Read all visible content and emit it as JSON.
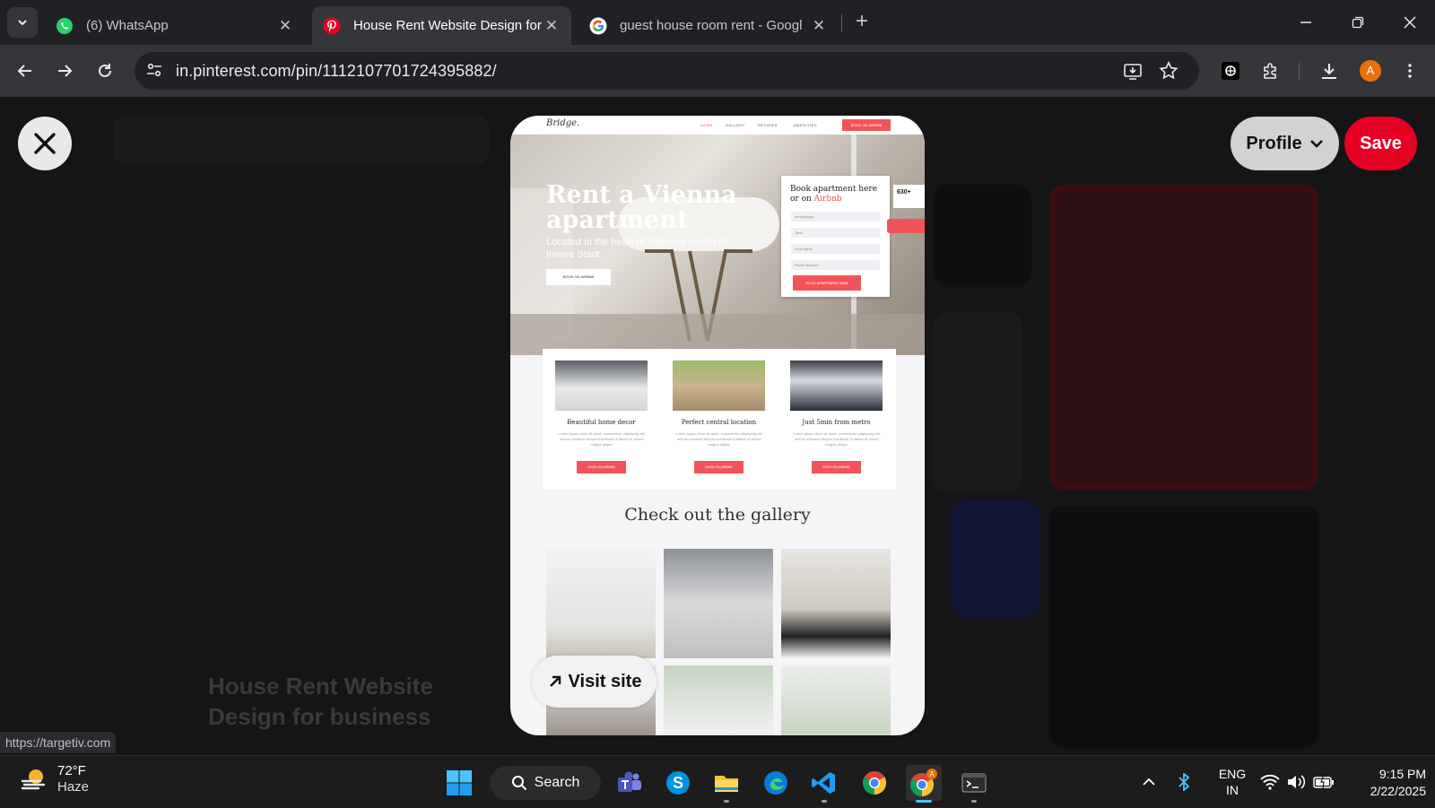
{
  "browser": {
    "tabs": [
      {
        "title": "(6) WhatsApp",
        "favicon": "whatsapp-icon",
        "active": false
      },
      {
        "title": "House Rent Website Design for",
        "favicon": "pinterest-icon",
        "active": true
      },
      {
        "title": "guest house room rent - Googl",
        "favicon": "google-icon",
        "active": false
      }
    ],
    "new_tab": "+",
    "url": "in.pinterest.com/pin/1112107701724395882/",
    "profile_initial": "A",
    "status_url": "https://targetiv.com"
  },
  "pin_page": {
    "profile_label": "Profile",
    "save_label": "Save",
    "visit_label": "Visit site",
    "background_title": "House Rent Website Design for business"
  },
  "mockup": {
    "logo": "Bridge.",
    "nav": [
      "HOME",
      "GALLERY",
      "REVIEWS",
      "AMENITIES"
    ],
    "nav_cta": "BOOK ON AIRBNB",
    "hero_title": "Rent a Vienna apartment",
    "hero_sub": "Located in the heart of historical center of Innere Stadt",
    "hero_button": "BOOK ON AIRBNB",
    "form_title_1": "Book apartment here",
    "form_title_2": "or on ",
    "form_airbnb": "Airbnb",
    "form_fields": [
      "mm/dd/yyyy",
      "Time",
      "Your Name",
      "Phone Number"
    ],
    "form_button": "BOOK APARTMENT NOW",
    "reviews_count": "630+",
    "features": [
      {
        "title": "Beautiful home decor",
        "text": "Lorem ipsum dolor sit amet, consectetur adipiscing elit, sed do eiusmod tempor incididunt ut labore et dolore magna aliqua.",
        "button": "BOOK ON AIRBNB"
      },
      {
        "title": "Perfect central location",
        "text": "Lorem ipsum dolor sit amet, consectetur adipiscing elit, sed do eiusmod tempor incididunt ut labore et dolore magna aliqua.",
        "button": "BOOK ON AIRBNB"
      },
      {
        "title": "Just 5min from metro",
        "text": "Lorem ipsum dolor sit amet, consectetur adipiscing elit, sed do eiusmod tempor incididunt ut labore et dolore magna aliqua.",
        "button": "BOOK ON AIRBNB"
      }
    ],
    "gallery_heading": "Check out the gallery"
  },
  "taskbar": {
    "temperature": "72°F",
    "condition": "Haze",
    "search_label": "Search",
    "lang_1": "ENG",
    "lang_2": "IN",
    "time": "9:15 PM",
    "date": "2/22/2025"
  },
  "colors": {
    "pinterest_red": "#e60023",
    "mockup_accent": "#f0545a",
    "chrome_dark": "#202124",
    "toolbar": "#35363a"
  }
}
